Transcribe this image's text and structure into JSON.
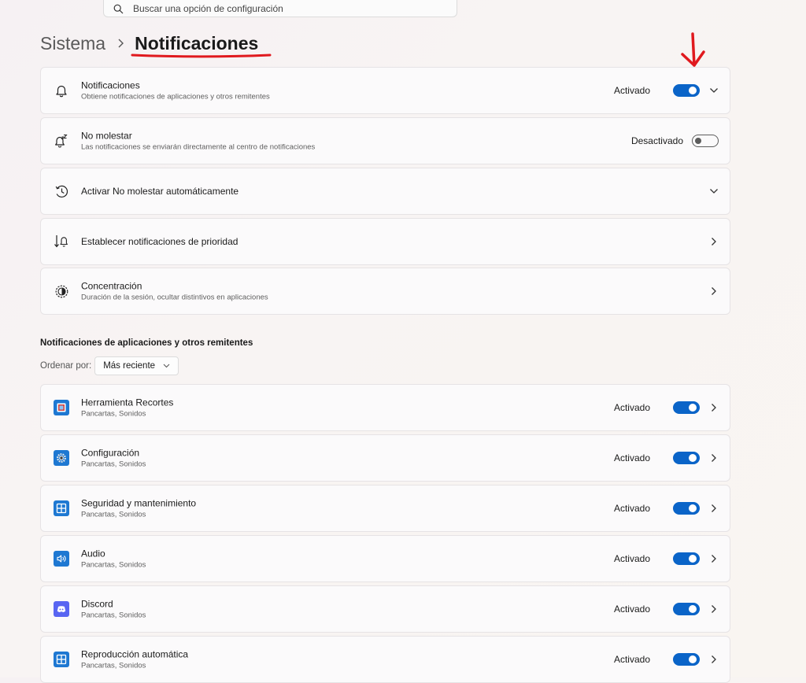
{
  "search": {
    "placeholder": "Buscar una opción de configuración"
  },
  "breadcrumb": {
    "parent": "Sistema",
    "current": "Notificaciones"
  },
  "settings": [
    {
      "title": "Notificaciones",
      "subtitle": "Obtiene notificaciones de aplicaciones y otros remitentes",
      "state": "Activado",
      "on": true,
      "icon": "bell-icon",
      "chevron": "down"
    },
    {
      "title": "No molestar",
      "subtitle": "Las notificaciones se enviarán directamente al centro de notificaciones",
      "state": "Desactivado",
      "on": false,
      "icon": "do-not-disturb-icon"
    },
    {
      "title": "Activar No molestar automáticamente",
      "icon": "clock-icon",
      "chevron": "down"
    },
    {
      "title": "Establecer notificaciones de prioridad",
      "icon": "priority-bell-icon",
      "chevron": "right"
    },
    {
      "title": "Concentración",
      "subtitle": "Duración de la sesión, ocultar distintivos en aplicaciones",
      "icon": "focus-icon",
      "chevron": "right"
    }
  ],
  "apps_section": {
    "title": "Notificaciones de aplicaciones y otros remitentes",
    "sort_label": "Ordenar por:",
    "sort_value": "Más reciente"
  },
  "apps": [
    {
      "name": "Herramienta Recortes",
      "subtitle": "Pancartas, Sonidos",
      "state": "Activado",
      "icon": "snipping-tool-icon"
    },
    {
      "name": "Configuración",
      "subtitle": "Pancartas, Sonidos",
      "state": "Activado",
      "icon": "settings-gear-icon"
    },
    {
      "name": "Seguridad y mantenimiento",
      "subtitle": "Pancartas, Sonidos",
      "state": "Activado",
      "icon": "security-maintenance-icon"
    },
    {
      "name": "Audio",
      "subtitle": "Pancartas, Sonidos",
      "state": "Activado",
      "icon": "audio-icon"
    },
    {
      "name": "Discord",
      "subtitle": "Pancartas, Sonidos",
      "state": "Activado",
      "icon": "discord-icon"
    },
    {
      "name": "Reproducción automática",
      "subtitle": "Pancartas, Sonidos",
      "state": "Activado",
      "icon": "autoplay-icon"
    }
  ],
  "colors": {
    "accent": "#0a64c8",
    "annotation": "#e0191e",
    "discord": "#5865f2"
  }
}
